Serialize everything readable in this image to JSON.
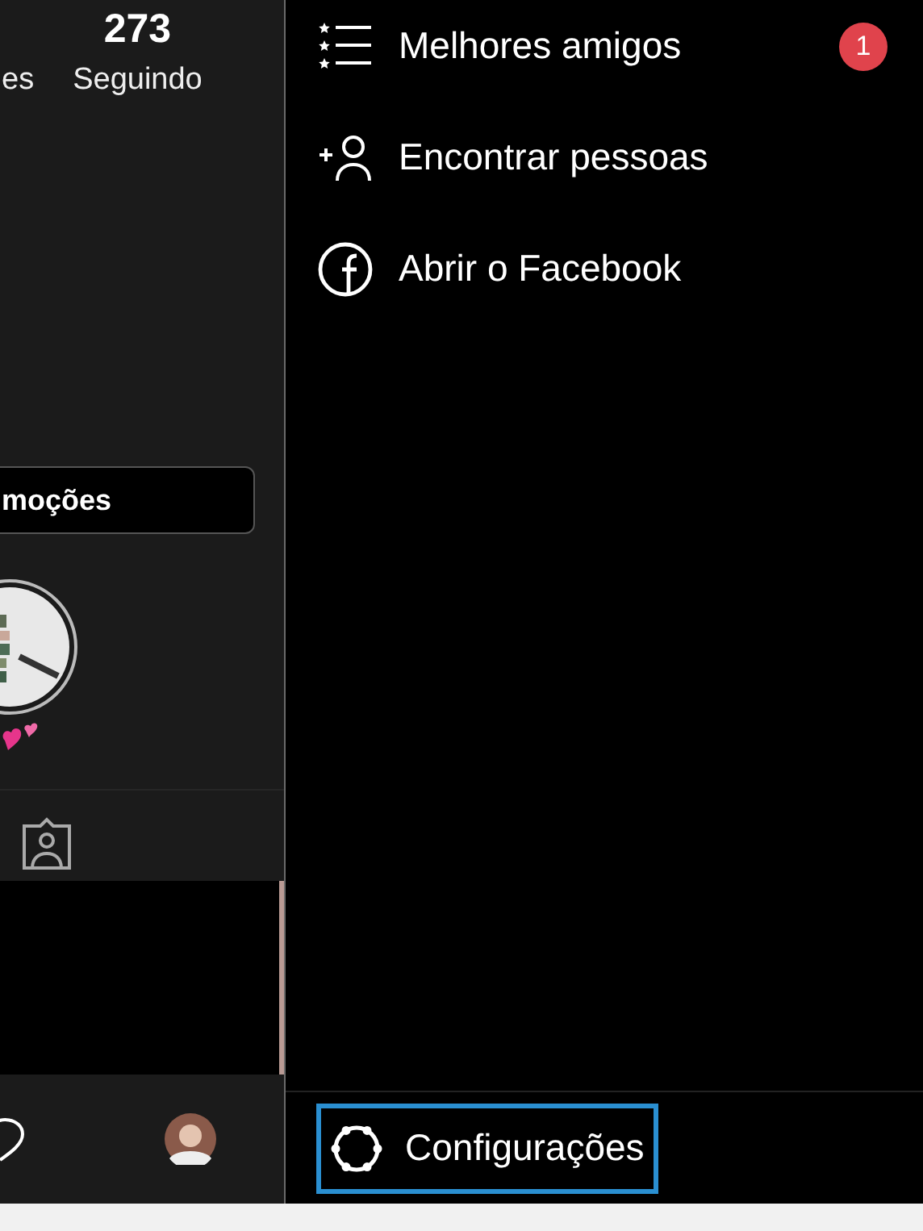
{
  "profile": {
    "stats": [
      {
        "label": "es"
      },
      {
        "value": "273",
        "label": "Seguindo"
      }
    ],
    "promo_button": "moções"
  },
  "drawer": {
    "items": [
      {
        "kind": "best-friends",
        "label": "Melhores amigos",
        "badge": "1"
      },
      {
        "kind": "find-people",
        "label": "Encontrar pessoas"
      },
      {
        "kind": "facebook",
        "label": "Abrir o Facebook"
      }
    ],
    "settings": {
      "label": "Configurações",
      "highlighted": true
    }
  }
}
